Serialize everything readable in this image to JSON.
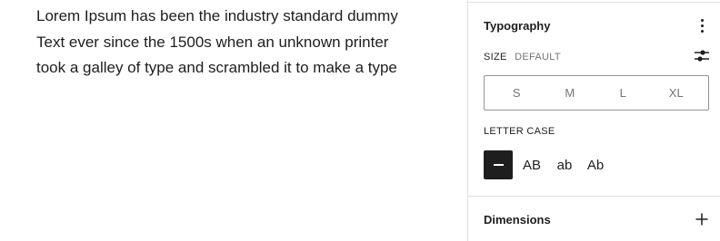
{
  "canvas": {
    "paragraph_lines": [
      "Lorem Ipsum has been the industry standard dummy",
      "Text ever since the 1500s when an unknown printer",
      "took a galley of type and scrambled it to make a type"
    ]
  },
  "sidebar": {
    "typography": {
      "title": "Typography",
      "options_icon": "more-vertical-icon"
    },
    "size": {
      "label": "SIZE",
      "current": "DEFAULT",
      "custom_icon": "settings-sliders-icon",
      "options": [
        "S",
        "M",
        "L",
        "XL"
      ]
    },
    "letter_case": {
      "label": "LETTER CASE",
      "none_icon": "dash-icon",
      "options": [
        "AB",
        "ab",
        "Ab"
      ],
      "selected": "none"
    },
    "dimensions": {
      "title": "Dimensions",
      "add_icon": "plus-icon"
    }
  },
  "colors": {
    "text": "#1e1e1e",
    "muted": "#757575",
    "border": "#e0e0e0",
    "control_border": "#949494",
    "selected_bg": "#1e1e1e"
  }
}
